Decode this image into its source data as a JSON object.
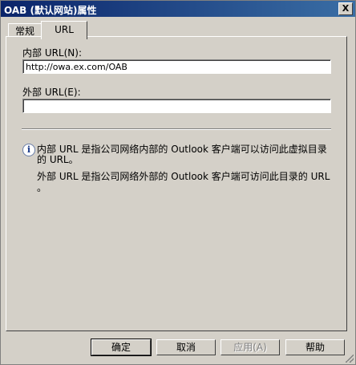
{
  "window": {
    "title": "OAB (默认网站)属性",
    "close_glyph": "X"
  },
  "tabs": [
    {
      "label": "常规"
    },
    {
      "label": "URL"
    }
  ],
  "form": {
    "internal_url_label": "内部 URL(N):",
    "internal_url_value": "http://owa.ex.com/OAB",
    "external_url_label": "外部 URL(E):",
    "external_url_value": ""
  },
  "info": {
    "icon": "info-icon",
    "line1": "内部 URL 是指公司网络内部的 Outlook 客户端可以访问此虚拟目录",
    "line2": "的 URL。",
    "line3": "外部 URL 是指公司网络外部的 Outlook 客户端可访问此目录的 URL",
    "line4": "。"
  },
  "buttons": {
    "ok": "确定",
    "cancel": "取消",
    "apply": "应用(A)",
    "help": "帮助"
  }
}
